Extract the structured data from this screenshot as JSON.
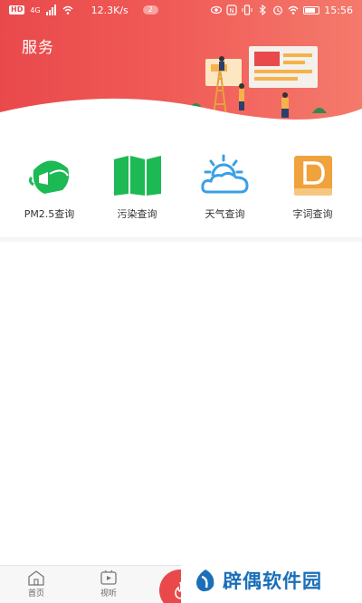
{
  "status_bar": {
    "hd_badge": "HD",
    "network": "4G",
    "speed": "12.3K/s",
    "battery_pill": "2",
    "time": "15:56",
    "icons": [
      "eye-icon",
      "nfc-icon",
      "vibrate-icon",
      "bluetooth-icon",
      "alarm-icon",
      "wifi-icon",
      "battery-icon"
    ]
  },
  "header": {
    "title": "服务",
    "background_color": "#e9494b"
  },
  "services": [
    {
      "label": "PM2.5查询",
      "icon": "mask-icon",
      "color": "#1db954"
    },
    {
      "label": "污染查询",
      "icon": "map-icon",
      "color": "#1db954"
    },
    {
      "label": "天气查询",
      "icon": "weather-icon",
      "color": "#3aa0e6"
    },
    {
      "label": "字词查询",
      "icon": "dictionary-icon",
      "color": "#f0a23c"
    }
  ],
  "tabbar": {
    "home_label": "首页",
    "watch_label": "视听",
    "center_icon": "flame-icon"
  },
  "watermark": {
    "text": "辟偶软件园"
  }
}
